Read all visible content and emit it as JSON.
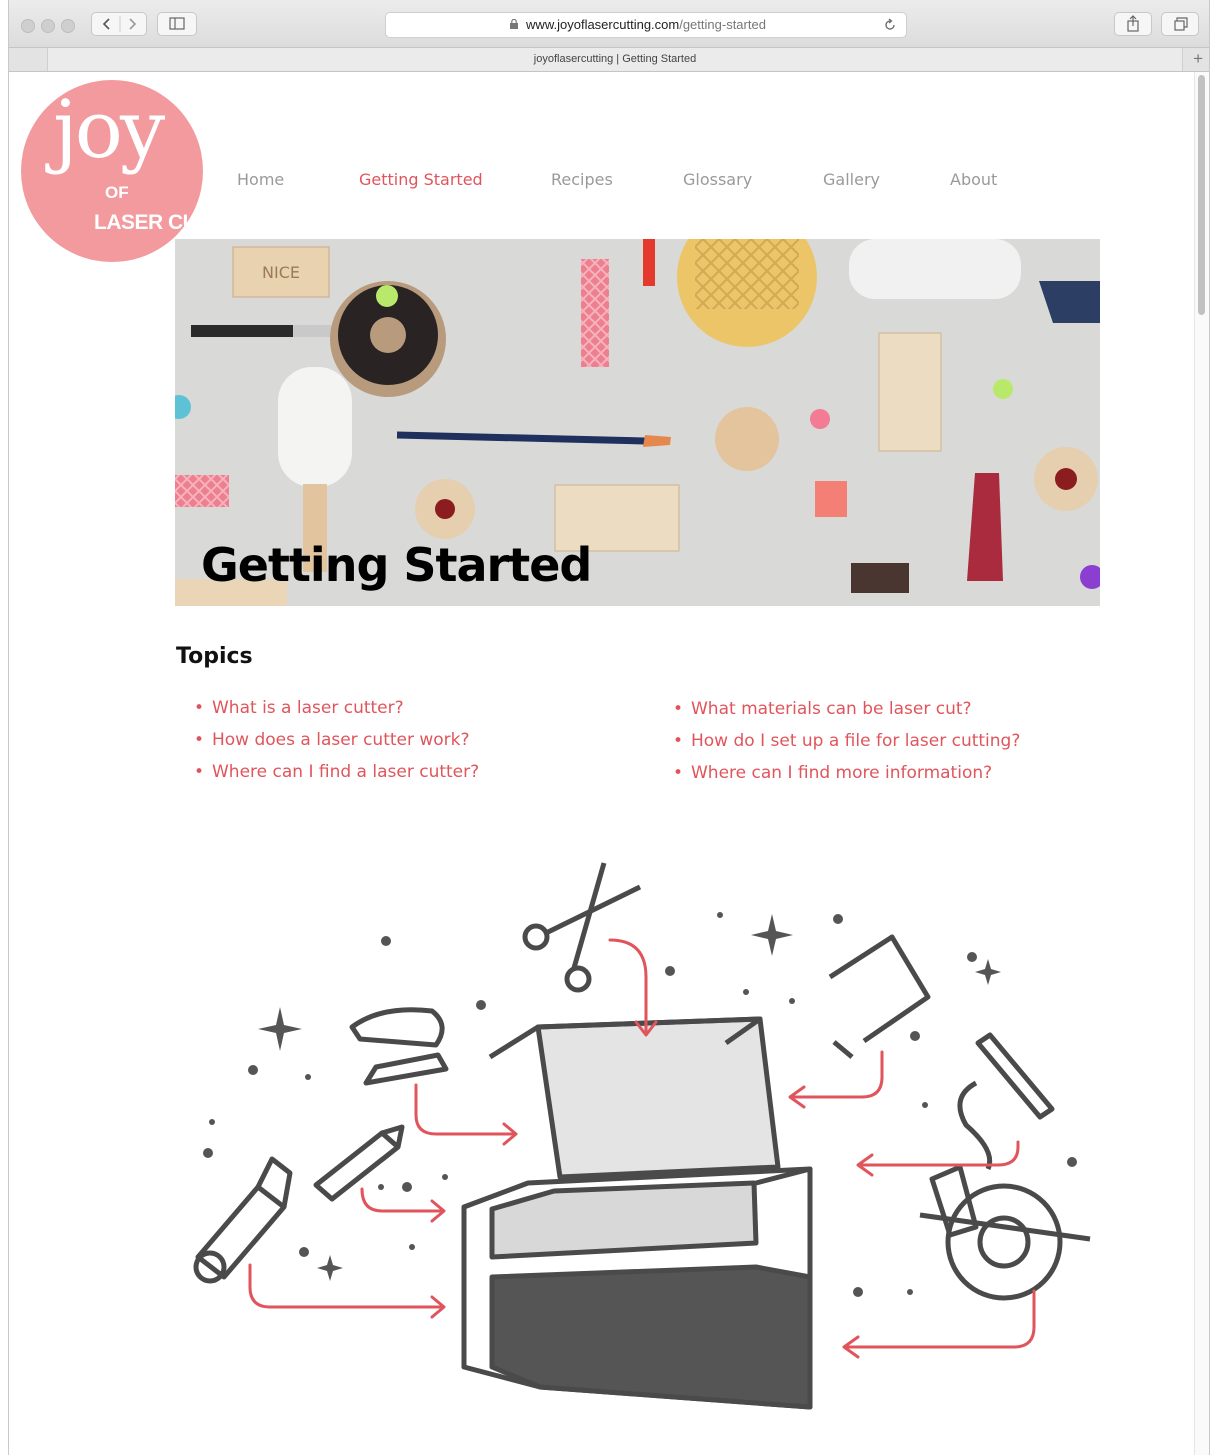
{
  "browser": {
    "url_domain": "www.joyoflasercutting.com",
    "url_path": "/getting-started",
    "tab_title": "joyoflasercutting | Getting Started",
    "new_tab_symbol": "+"
  },
  "logo": {
    "line1": "joy",
    "line2": "OF",
    "line3": "LASER CUTTING"
  },
  "nav": {
    "items": [
      {
        "label": "Home",
        "active": false
      },
      {
        "label": "Getting Started",
        "active": true
      },
      {
        "label": "Recipes",
        "active": false
      },
      {
        "label": "Glossary",
        "active": false
      },
      {
        "label": "Gallery",
        "active": false
      },
      {
        "label": "About",
        "active": false
      }
    ]
  },
  "hero": {
    "title": "Getting Started",
    "biscuit_text": "NICE"
  },
  "topics": {
    "heading": "Topics",
    "left": [
      "What is a laser cutter?",
      "How does a laser cutter work?",
      "Where can I find a laser cutter?"
    ],
    "right": [
      "What materials can be laser cut?",
      "How do I set up a file for laser cutting?",
      "Where can I find more information?"
    ]
  },
  "colors": {
    "accent": "#e0555c",
    "logo": "#f29a9d",
    "nav_inactive": "#9a9a9a"
  }
}
